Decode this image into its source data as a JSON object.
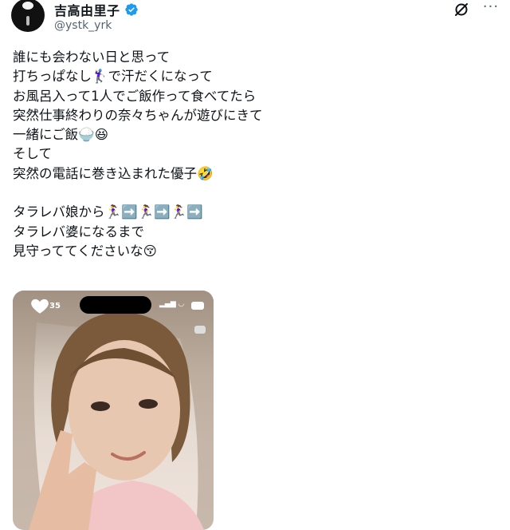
{
  "user": {
    "name": "吉高由里子",
    "handle": "@ystk_yrk"
  },
  "tweet": {
    "lines": [
      "誰にも会わない日と思って",
      "打ちっぱなし🏌️‍♀️で汗だくになって",
      "お風呂入って1人でご飯作って食べてたら",
      "突然仕事終わりの奈々ちゃんが遊びにきて",
      "一緒にご飯🍚😆",
      "そして",
      "突然の電話に巻き込まれた優子🤣",
      "",
      "タラレバ娘から🏃‍♀️➡️🏃‍♀️➡️🏃‍♀️➡️",
      "タラレバ婆になるまで",
      "見守っててくださいな😚"
    ]
  },
  "media": {
    "likes": "35"
  },
  "colors": {
    "verified": "#1d9bf0",
    "text": "#0f1419",
    "secondary": "#536471"
  },
  "icons": [
    "verified-badge-icon",
    "grok-icon",
    "more-icon",
    "heart-icon"
  ]
}
